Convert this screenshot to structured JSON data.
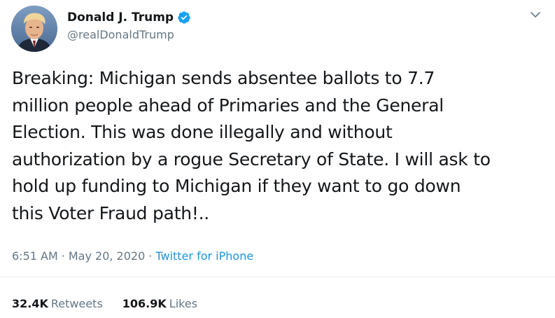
{
  "author": {
    "display_name": "Donald J. Trump",
    "handle": "@realDonaldTrump",
    "verified": true,
    "avatar_icon": "profile-photo"
  },
  "tweet": {
    "text": "Breaking: Michigan sends absentee ballots to 7.7\nmillion people ahead of Primaries and the General\nElection. This was done illegally and without\nauthorization by a rogue Secretary of State. I will ask to\nhold up funding to Michigan if they want to go down\nthis Voter Fraud path!..",
    "time": "6:51 AM",
    "separator": "·",
    "date": "May 20, 2020",
    "source": "Twitter for iPhone"
  },
  "stats": {
    "retweets_count": "32.4K",
    "retweets_label": "Retweets",
    "likes_count": "106.9K",
    "likes_label": "Likes"
  },
  "colors": {
    "text": "#14171a",
    "secondary": "#657786",
    "link": "#1b95e0",
    "verified": "#1da1f2",
    "divider": "#e6ecf0"
  },
  "icons": {
    "verified": "verified-badge-icon",
    "menu": "chevron-down-icon"
  }
}
